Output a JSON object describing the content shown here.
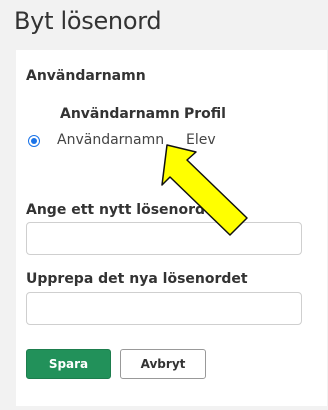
{
  "page": {
    "title": "Byt lösenord"
  },
  "account_section": {
    "label": "Användarnamn",
    "columns": [
      "Användarnamn",
      "Profil"
    ],
    "rows": [
      {
        "username": "Användarnamn",
        "profile": "Elev",
        "selected": true
      }
    ]
  },
  "form": {
    "new_password_label": "Ange ett nytt lösenord",
    "new_password_value": "",
    "repeat_password_label": "Upprepa det nya lösenordet",
    "repeat_password_value": ""
  },
  "actions": {
    "save_label": "Spara",
    "cancel_label": "Avbryt"
  },
  "annotation": {
    "icon": "yellow-arrow-icon",
    "color": "#ffff00"
  },
  "colors": {
    "save_button": "#22915a",
    "radio": "#1a73e8"
  }
}
